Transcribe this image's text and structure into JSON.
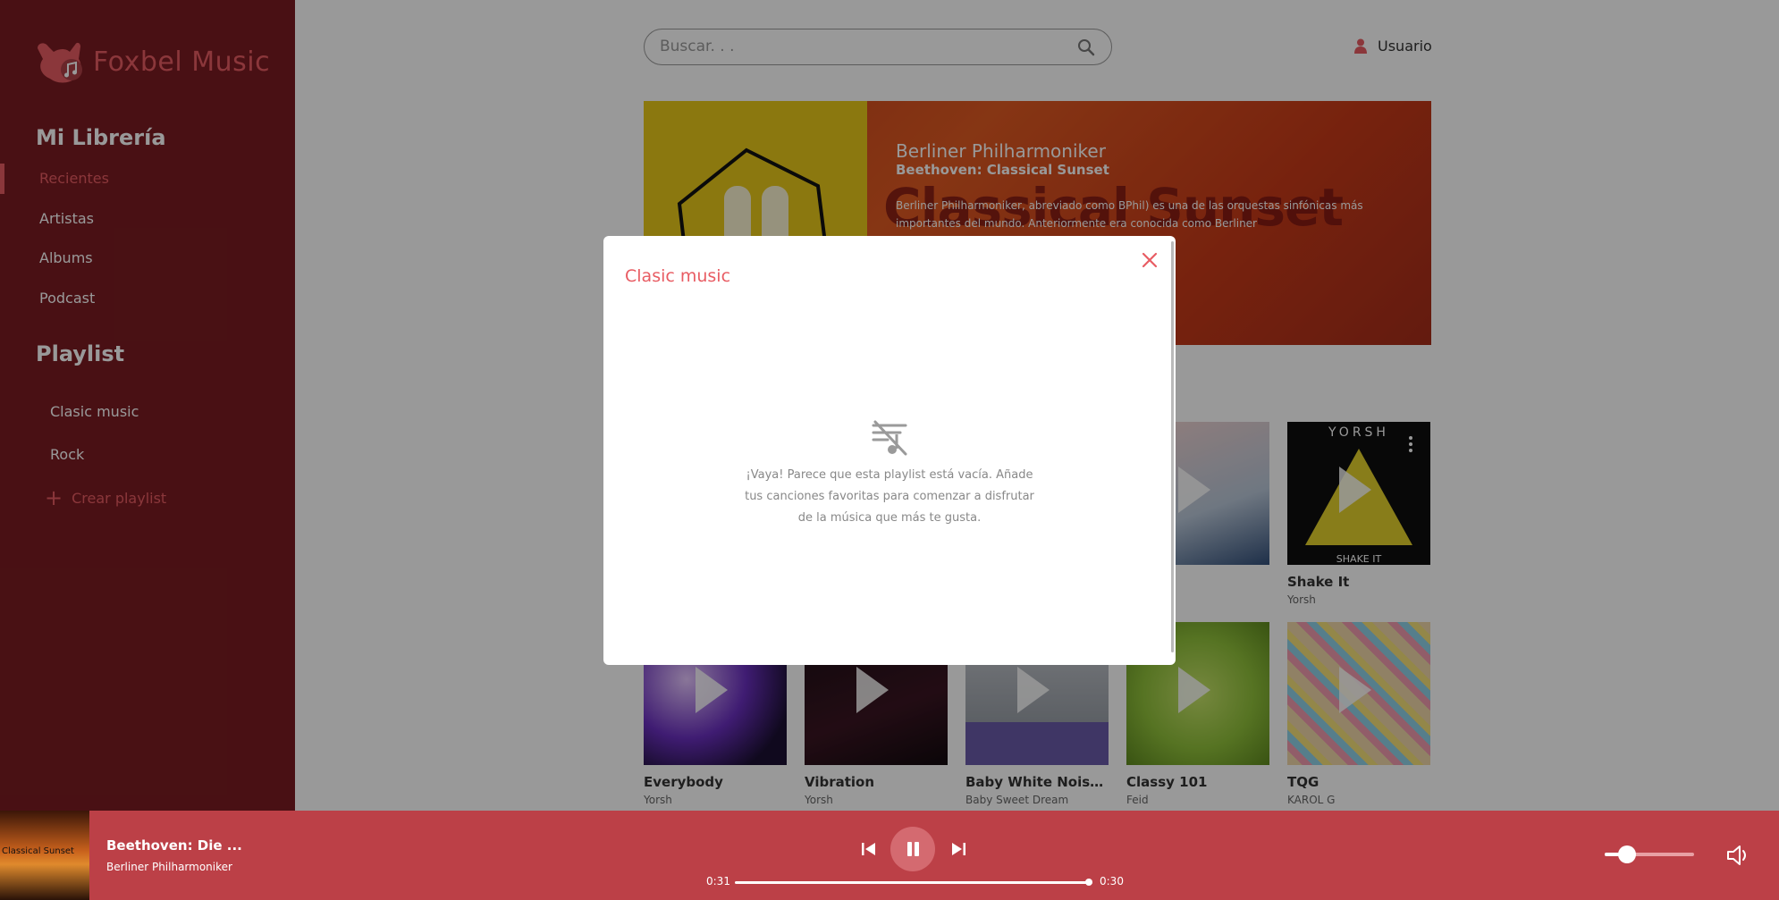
{
  "app": {
    "name": "Foxbel Music"
  },
  "sidebar": {
    "library_title": "Mi Librería",
    "nav": [
      {
        "label": "Recientes",
        "active": true
      },
      {
        "label": "Artistas",
        "active": false
      },
      {
        "label": "Albums",
        "active": false
      },
      {
        "label": "Podcast",
        "active": false
      }
    ],
    "playlist_title": "Playlist",
    "playlists": [
      {
        "label": "Clasic music"
      },
      {
        "label": "Rock"
      }
    ],
    "create_playlist_label": "Crear playlist"
  },
  "header": {
    "search_placeholder": "Buscar. . .",
    "user_label": "Usuario"
  },
  "banner": {
    "artist": "Berliner Philharmoniker",
    "album": "Beethoven: Classical Sunset",
    "big_text": "Classical Sunset",
    "description": "Berliner Philharmoniker, abreviado como BPhil) es una de las orquestas sinfónicas más importantes del mundo. Anteriormente era conocida como Berliner"
  },
  "cards": [
    {
      "title": "Shake It",
      "artist": "Yorsh",
      "cover_color": "#0e0e0e"
    },
    {
      "title": "Everybody",
      "artist": "Yorsh",
      "cover_color": "#3a1e6e"
    },
    {
      "title": "Vibration",
      "artist": "Yorsh",
      "cover_color": "#1a0f14"
    },
    {
      "title": "Baby White Noise Ser...",
      "artist": "Baby Sweet Dream",
      "cover_color": "#9aa0a8"
    },
    {
      "title": "Classy 101",
      "artist": "Feid",
      "cover_color": "#8fc03a"
    },
    {
      "title": "TQG",
      "artist": "KAROL G",
      "cover_color": "#f0d7a8"
    }
  ],
  "modal": {
    "title": "Clasic music",
    "empty_message": "¡Vaya! Parece que esta playlist está vacía. Añade tus canciones favoritas para comenzar a disfrutar de la música que más te gusta."
  },
  "player": {
    "song_title": "Beethoven: Die ...",
    "artist": "Berliner Philharmoniker",
    "cover_text": "Classical Sunset",
    "current_time": "0:31",
    "total_time": "0:30",
    "progress_fraction": 0.99,
    "volume_fraction": 0.25
  },
  "colors": {
    "sidebar_bg": "#7a1c22",
    "accent": "#e85c63",
    "player_bg": "#bc4047"
  },
  "icons": {
    "search": "search-icon",
    "user": "user-icon",
    "close": "close-icon",
    "empty": "music-off-icon",
    "prev": "skip-previous-icon",
    "pause": "pause-icon",
    "next": "skip-next-icon",
    "volume": "volume-icon"
  }
}
